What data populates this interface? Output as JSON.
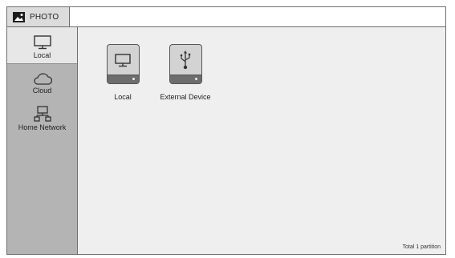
{
  "app": {
    "tab_label": "PHOTO"
  },
  "sidebar": {
    "items": [
      {
        "label": "Local",
        "icon": "monitor-icon",
        "active": true
      },
      {
        "label": "Cloud",
        "icon": "cloud-icon",
        "active": false
      },
      {
        "label": "Home Network",
        "icon": "network-icon",
        "active": false
      }
    ]
  },
  "main": {
    "devices": [
      {
        "label": "Local",
        "icon": "monitor-drive-icon"
      },
      {
        "label": "External Device",
        "icon": "usb-drive-icon"
      }
    ],
    "status": "Total 1 partition"
  }
}
